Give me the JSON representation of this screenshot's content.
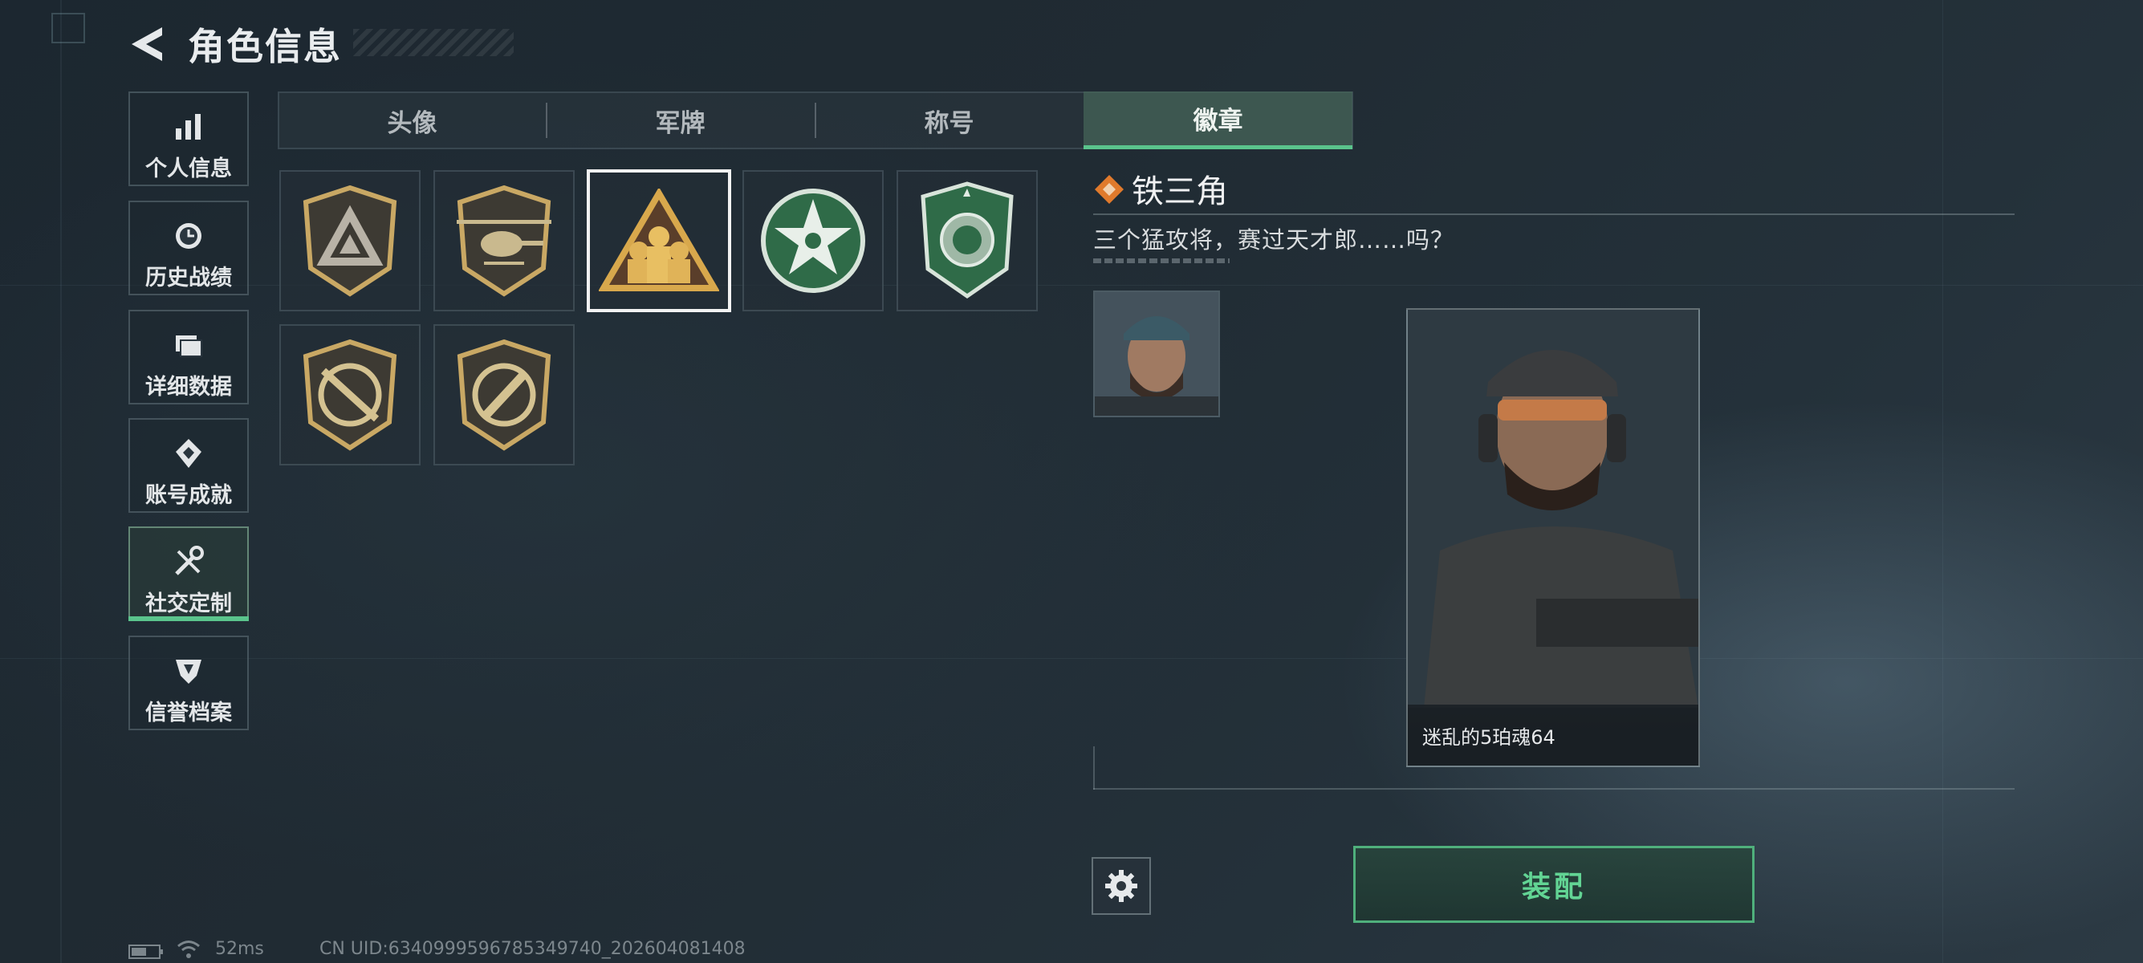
{
  "header": {
    "title": "角色信息"
  },
  "sidebar": {
    "items": [
      {
        "label": "个人信息",
        "icon": "bar-chart-icon"
      },
      {
        "label": "历史战绩",
        "icon": "clock-history-icon"
      },
      {
        "label": "详细数据",
        "icon": "folder-icon"
      },
      {
        "label": "账号成就",
        "icon": "achievement-icon"
      },
      {
        "label": "社交定制",
        "icon": "tools-icon",
        "active": true
      },
      {
        "label": "信誉档案",
        "icon": "credit-shield-icon"
      }
    ]
  },
  "tabs": [
    {
      "label": "头像"
    },
    {
      "label": "军牌"
    },
    {
      "label": "称号"
    },
    {
      "label": "徽章",
      "active": true
    }
  ],
  "badges": [
    {
      "name": "triangle-shield-badge",
      "selected": false
    },
    {
      "name": "helicopter-badge",
      "selected": false
    },
    {
      "name": "iron-triangle-badge",
      "selected": true
    },
    {
      "name": "green-star-badge",
      "selected": false
    },
    {
      "name": "green-emblem-badge",
      "selected": false
    },
    {
      "name": "rifle-badge",
      "selected": false
    },
    {
      "name": "knife-badge",
      "selected": false
    }
  ],
  "detail": {
    "name": "铁三角",
    "description": "三个猛攻将，赛过天才郎……吗？",
    "character_name": "迷乱的5珀魂64"
  },
  "actions": {
    "equip_label": "装配"
  },
  "status": {
    "ping": "52ms",
    "uid": "CN UID:6340999596785349740_202604081408"
  },
  "colors": {
    "accent": "#5ac48c",
    "badge_gold": "#c9a864",
    "badge_green": "#2f6b48"
  }
}
